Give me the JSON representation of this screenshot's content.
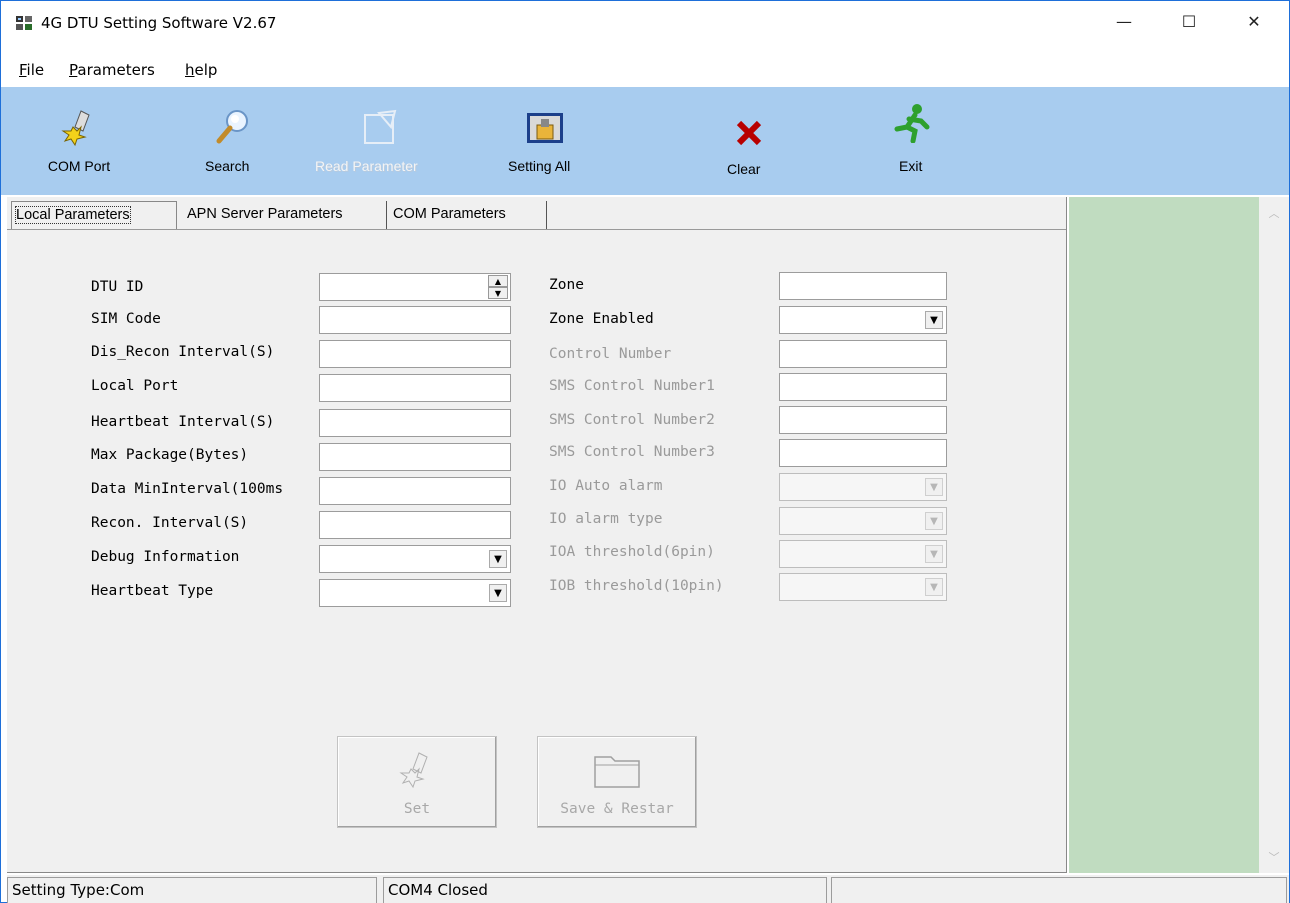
{
  "window": {
    "title": "4G DTU Setting Software V2.67",
    "minimize": "—",
    "maximize": "☐",
    "close": "✕"
  },
  "menu": [
    {
      "accel": "F",
      "rest": "ile"
    },
    {
      "accel": "P",
      "rest": "arameters"
    },
    {
      "accel": "h",
      "rest": "elp"
    }
  ],
  "toolbar": {
    "com_port": "COM Port",
    "search": "Search",
    "read_parameter": "Read Parameter",
    "setting_all": "Setting All",
    "clear": "Clear",
    "exit": "Exit"
  },
  "tabs": {
    "local": "Local Parameters",
    "apn": "APN Server Parameters",
    "com": "COM Parameters"
  },
  "left_fields": [
    {
      "label": "DTU ID",
      "value": ""
    },
    {
      "label": "SIM Code",
      "value": ""
    },
    {
      "label": "Dis_Recon Interval(S)",
      "value": ""
    },
    {
      "label": "Local Port",
      "value": ""
    },
    {
      "label": "Heartbeat Interval(S)",
      "value": ""
    },
    {
      "label": "Max Package(Bytes)",
      "value": ""
    },
    {
      "label": "Data MinInterval(100ms",
      "value": ""
    },
    {
      "label": "Recon. Interval(S)",
      "value": ""
    },
    {
      "label": "Debug Information",
      "value": ""
    },
    {
      "label": "Heartbeat Type",
      "value": ""
    }
  ],
  "right_fields": [
    {
      "label": "Zone",
      "value": ""
    },
    {
      "label": "Zone Enabled",
      "value": ""
    },
    {
      "label": "Control Number",
      "value": ""
    },
    {
      "label": "SMS Control Number1",
      "value": ""
    },
    {
      "label": "SMS Control Number2",
      "value": ""
    },
    {
      "label": "SMS Control Number3",
      "value": ""
    },
    {
      "label": "IO Auto alarm",
      "value": ""
    },
    {
      "label": "IO alarm type",
      "value": ""
    },
    {
      "label": "IOA threshold(6pin)",
      "value": ""
    },
    {
      "label": "IOB threshold(10pin)",
      "value": ""
    }
  ],
  "buttons": {
    "set": "Set",
    "save_restart": "Save & Restar"
  },
  "status": {
    "setting_type": "Setting Type:Com",
    "port_state": "COM4 Closed",
    "extra": ""
  },
  "colors": {
    "toolbar_bg": "#a8ccef",
    "side_panel_bg": "#c0dcc0",
    "disabled_text": "#9a9a9a"
  }
}
